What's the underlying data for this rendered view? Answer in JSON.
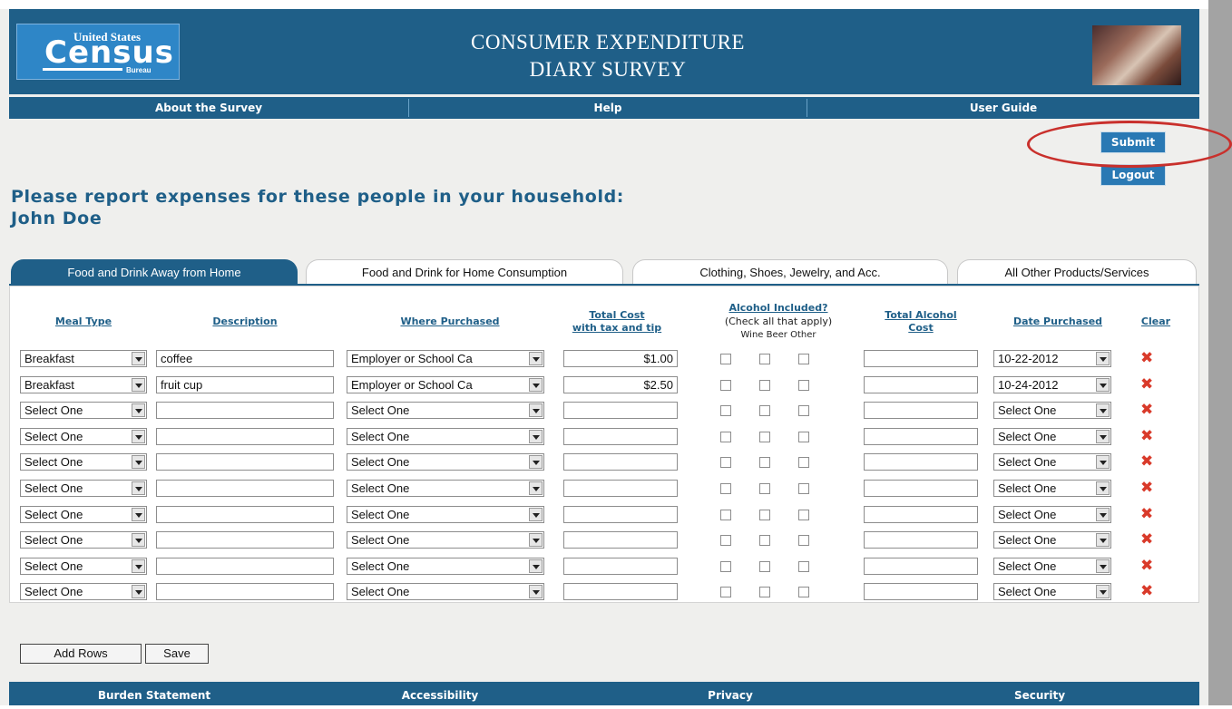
{
  "header": {
    "logo": {
      "united_states": "United States",
      "census": "Census",
      "bureau": "Bureau"
    },
    "title_line1": "CONSUMER EXPENDITURE",
    "title_line2": "DIARY SURVEY"
  },
  "nav": {
    "items": [
      "About the Survey",
      "Help",
      "User Guide"
    ]
  },
  "actions": {
    "submit": "Submit",
    "logout": "Logout"
  },
  "page": {
    "heading": "Please report expenses for these people in your household:",
    "person": "John Doe"
  },
  "tabs": [
    {
      "label": "Food and Drink Away from Home",
      "active": true
    },
    {
      "label": "Food and Drink for Home Consumption",
      "active": false
    },
    {
      "label": "Clothing, Shoes, Jewelry, and Acc.",
      "active": false
    },
    {
      "label": "All Other Products/Services",
      "active": false
    }
  ],
  "table": {
    "headers": {
      "meal_type": "Meal Type",
      "description": "Description",
      "where_purchased": "Where Purchased",
      "total_cost_1": "Total Cost",
      "total_cost_2": "with tax and tip",
      "alcohol_1": "Alcohol Included?",
      "alcohol_2": "(Check all that apply)",
      "alcohol_3": "Wine Beer Other",
      "total_alcohol_1": "Total Alcohol",
      "total_alcohol_2": "Cost",
      "date_purchased": "Date Purchased",
      "clear": "Clear"
    },
    "rows": [
      {
        "meal_type": "Breakfast",
        "description": "coffee",
        "where": "Employer or School Ca",
        "cost": "$1.00",
        "alcohol_cost": "",
        "date": "10-22-2012"
      },
      {
        "meal_type": "Breakfast",
        "description": "fruit cup",
        "where": "Employer or School Ca",
        "cost": "$2.50",
        "alcohol_cost": "",
        "date": "10-24-2012"
      },
      {
        "meal_type": "Select One",
        "description": "",
        "where": "Select One",
        "cost": "",
        "alcohol_cost": "",
        "date": "Select One"
      },
      {
        "meal_type": "Select One",
        "description": "",
        "where": "Select One",
        "cost": "",
        "alcohol_cost": "",
        "date": "Select One"
      },
      {
        "meal_type": "Select One",
        "description": "",
        "where": "Select One",
        "cost": "",
        "alcohol_cost": "",
        "date": "Select One"
      },
      {
        "meal_type": "Select One",
        "description": "",
        "where": "Select One",
        "cost": "",
        "alcohol_cost": "",
        "date": "Select One"
      },
      {
        "meal_type": "Select One",
        "description": "",
        "where": "Select One",
        "cost": "",
        "alcohol_cost": "",
        "date": "Select One"
      },
      {
        "meal_type": "Select One",
        "description": "",
        "where": "Select One",
        "cost": "",
        "alcohol_cost": "",
        "date": "Select One"
      },
      {
        "meal_type": "Select One",
        "description": "",
        "where": "Select One",
        "cost": "",
        "alcohol_cost": "",
        "date": "Select One"
      },
      {
        "meal_type": "Select One",
        "description": "",
        "where": "Select One",
        "cost": "",
        "alcohol_cost": "",
        "date": "Select One"
      }
    ],
    "clear_icon": "close-x-icon"
  },
  "bottom_buttons": {
    "add_rows": "Add Rows",
    "save": "Save"
  },
  "footer": {
    "items": [
      "Burden Statement",
      "Accessibility",
      "Privacy",
      "Security"
    ]
  },
  "colors": {
    "brand_blue": "#1f5f88",
    "button_blue": "#2a79b4",
    "clear_red": "#d93a2a",
    "highlight_ellipse": "#c9302c"
  }
}
